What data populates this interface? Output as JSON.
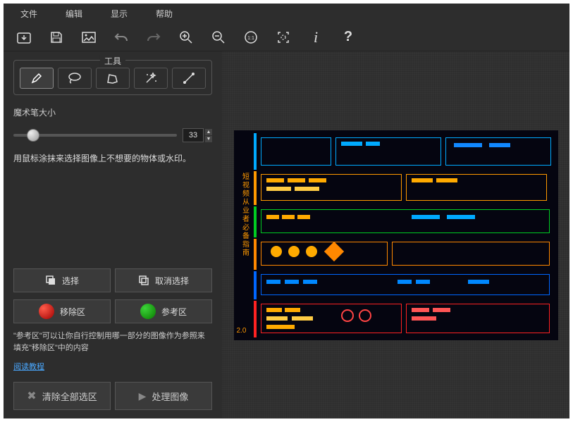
{
  "menu": {
    "file": "文件",
    "edit": "编辑",
    "view": "显示",
    "help": "帮助"
  },
  "tools": {
    "legend": "工具",
    "brush_label": "魔术笔大小",
    "brush_value": "33",
    "hint": "用鼠标涂抹来选择图像上不想要的物体或水印。"
  },
  "buttons": {
    "select": "选择",
    "deselect": "取消选择",
    "remove_zone": "移除区",
    "ref_zone": "参考区",
    "note": "\"参考区\"可以让你自行控制用哪一部分的图像作为参照来填充\"移除区\"中的内容",
    "tutorial": "阅读教程",
    "clear_all": "清除全部选区",
    "process": "处理图像"
  },
  "image": {
    "vertical_label": "短视频从业者必备指南",
    "version": "2.0"
  }
}
